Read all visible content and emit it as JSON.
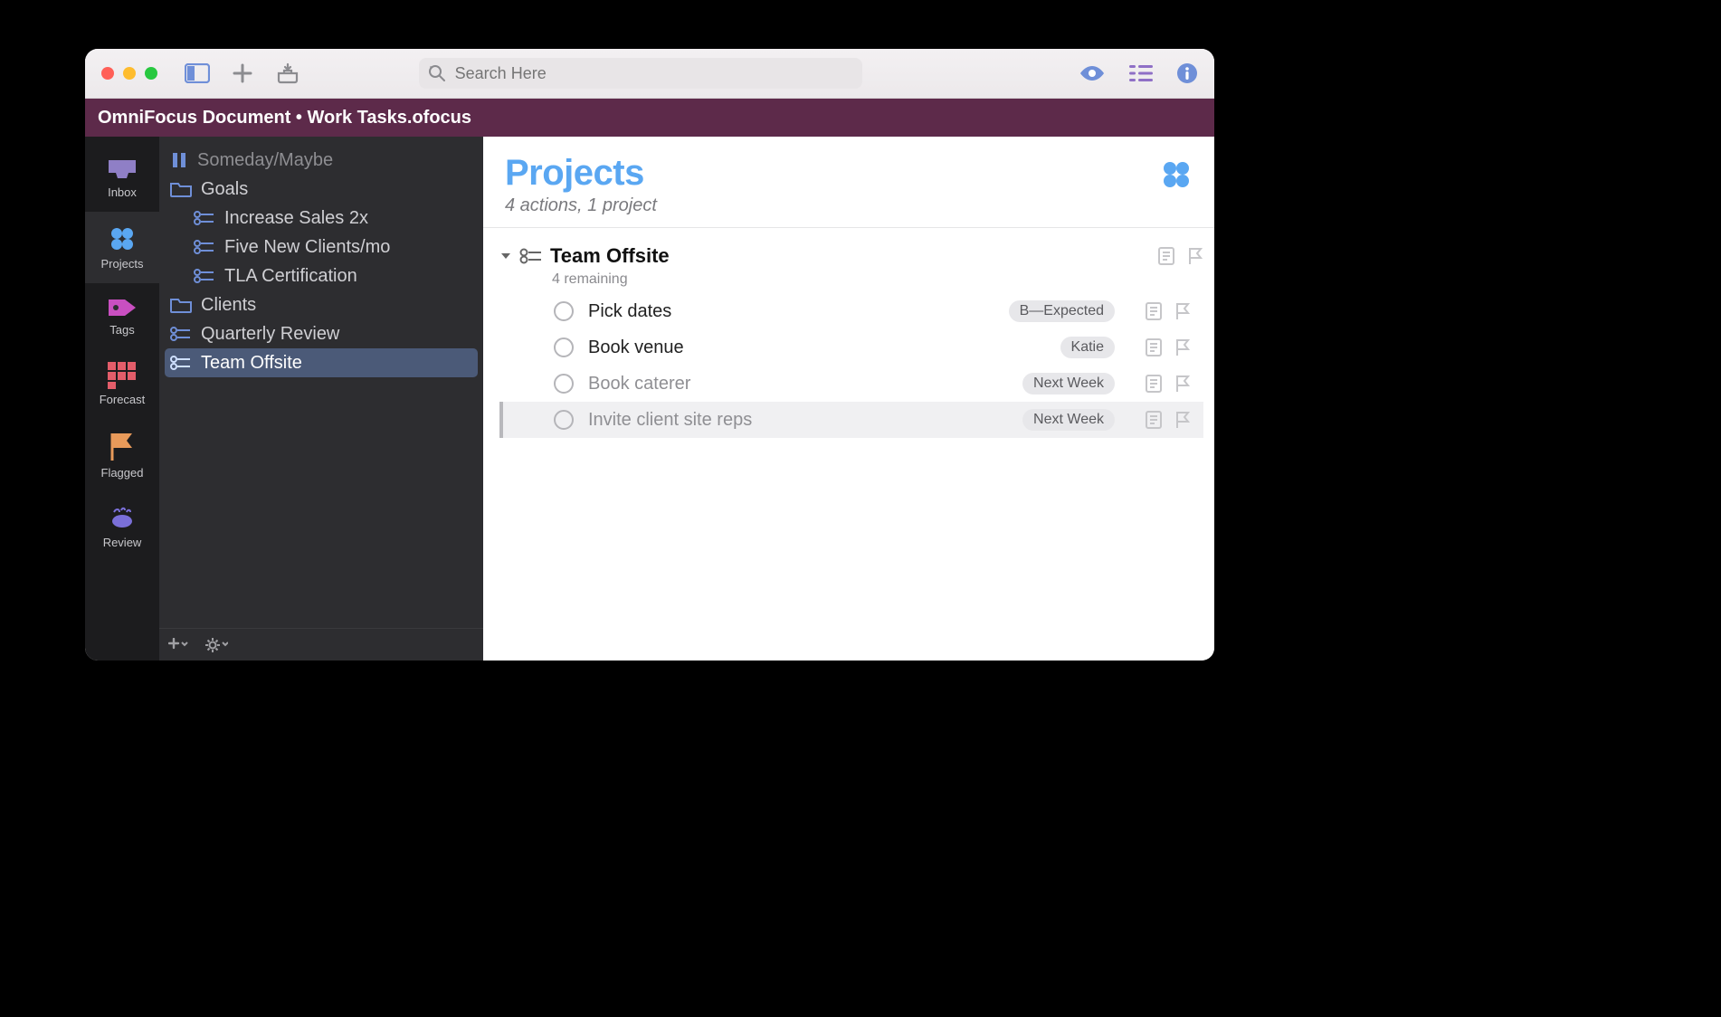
{
  "toolbar": {
    "search_placeholder": "Search Here"
  },
  "document_title": "OmniFocus Document • Work Tasks.ofocus",
  "perspectives": [
    {
      "id": "inbox",
      "label": "Inbox"
    },
    {
      "id": "projects",
      "label": "Projects"
    },
    {
      "id": "tags",
      "label": "Tags"
    },
    {
      "id": "forecast",
      "label": "Forecast"
    },
    {
      "id": "flagged",
      "label": "Flagged"
    },
    {
      "id": "review",
      "label": "Review"
    }
  ],
  "outline": {
    "someday": "Someday/Maybe",
    "goals_folder": "Goals",
    "goals": [
      "Increase Sales 2x",
      "Five New Clients/mo",
      "TLA Certification"
    ],
    "clients_folder": "Clients",
    "quarterly_review": "Quarterly Review",
    "team_offsite": "Team Offsite"
  },
  "content": {
    "title": "Projects",
    "subtitle": "4 actions, 1 project",
    "project": {
      "name": "Team Offsite",
      "remaining": "4 remaining",
      "tasks": [
        {
          "title": "Pick dates",
          "tag": "B—Expected",
          "dim": false
        },
        {
          "title": "Book venue",
          "tag": "Katie",
          "dim": false
        },
        {
          "title": "Book caterer",
          "tag": "Next Week",
          "dim": true
        },
        {
          "title": "Invite client site reps",
          "tag": "Next Week",
          "dim": true,
          "selected": true
        }
      ]
    }
  }
}
